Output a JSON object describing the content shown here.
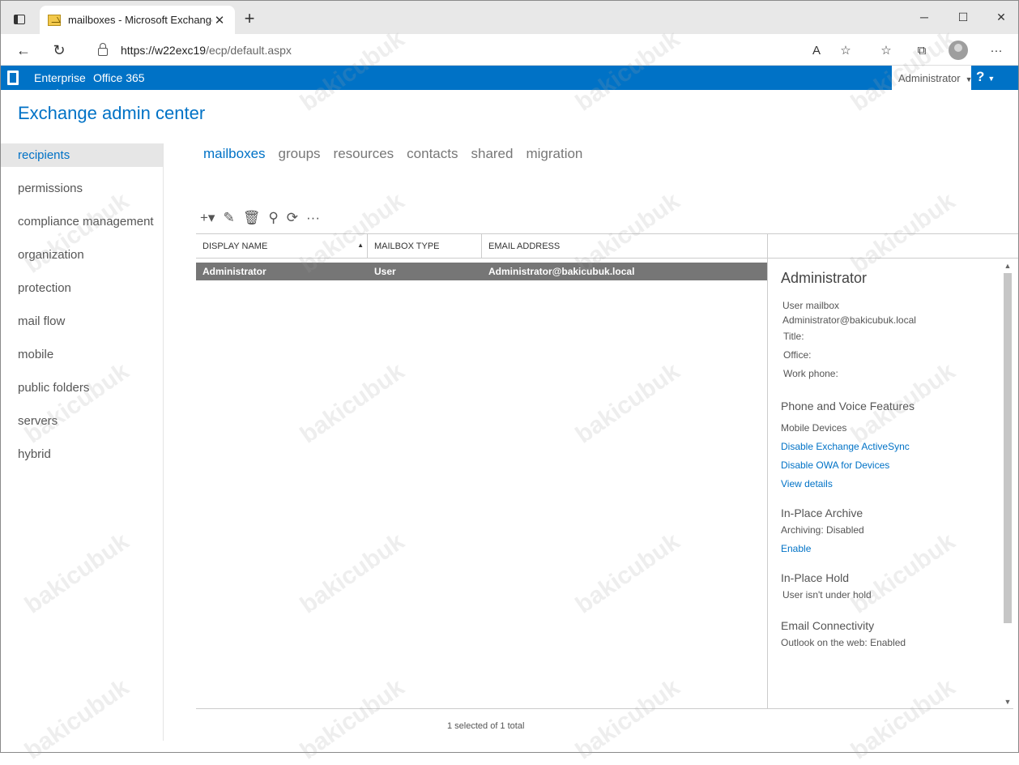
{
  "browser": {
    "tab_title": "mailboxes - Microsoft Exchange",
    "tab_close": "✕",
    "new_tab": "+",
    "minimize": "─",
    "maximize": "☐",
    "close": "✕",
    "back": "←",
    "reload": "↻",
    "url_host": "https://w22exc19",
    "url_path": "/ecp/default.aspx",
    "read_aloud": "A",
    "add_favorite": "☆",
    "favorites": "☆",
    "collections": "⧉",
    "more": "···"
  },
  "topbar": {
    "enterprise": "Enterprise",
    "office365": "Office 365",
    "user": "Administrator",
    "user_caret": "▼",
    "help": "?",
    "help_caret": "▼"
  },
  "eac": {
    "title": "Exchange admin center"
  },
  "leftnav": {
    "items": [
      "recipients",
      "permissions",
      "compliance management",
      "organization",
      "protection",
      "mail flow",
      "mobile",
      "public folders",
      "servers",
      "hybrid"
    ]
  },
  "subtabs": [
    "mailboxes",
    "groups",
    "resources",
    "contacts",
    "shared",
    "migration"
  ],
  "toolbar": {
    "add": "+▾",
    "edit": "✎",
    "delete": "🗑",
    "search": "⚲",
    "refresh": "⟳",
    "more": "···"
  },
  "grid": {
    "columns": [
      "DISPLAY NAME",
      "MAILBOX TYPE",
      "EMAIL ADDRESS"
    ],
    "sort_indicator": "▲",
    "rows": [
      {
        "display_name": "Administrator",
        "mailbox_type": "User",
        "email": "Administrator@bakicubuk.local"
      }
    ]
  },
  "details": {
    "name": "Administrator",
    "mailbox_kind": "User mailbox",
    "email": "Administrator@bakicubuk.local",
    "title_label": "Title:",
    "office_label": "Office:",
    "work_phone_label": "Work phone:",
    "phone_voice_heading": "Phone and Voice Features",
    "mobile_devices": "Mobile Devices",
    "disable_activesync": "Disable Exchange ActiveSync",
    "disable_owa": "Disable OWA for Devices",
    "view_details": "View details",
    "archive_heading": "In-Place Archive",
    "archiving": "Archiving:  Disabled",
    "enable": "Enable",
    "hold_heading": "In-Place Hold",
    "hold_status": "User isn't under hold",
    "connectivity_heading": "Email Connectivity",
    "owa_status": "Outlook on the web:  Enabled"
  },
  "scroll": {
    "up": "▲",
    "down": "▼"
  },
  "status": "1 selected of 1 total",
  "watermark": "bakicubuk"
}
